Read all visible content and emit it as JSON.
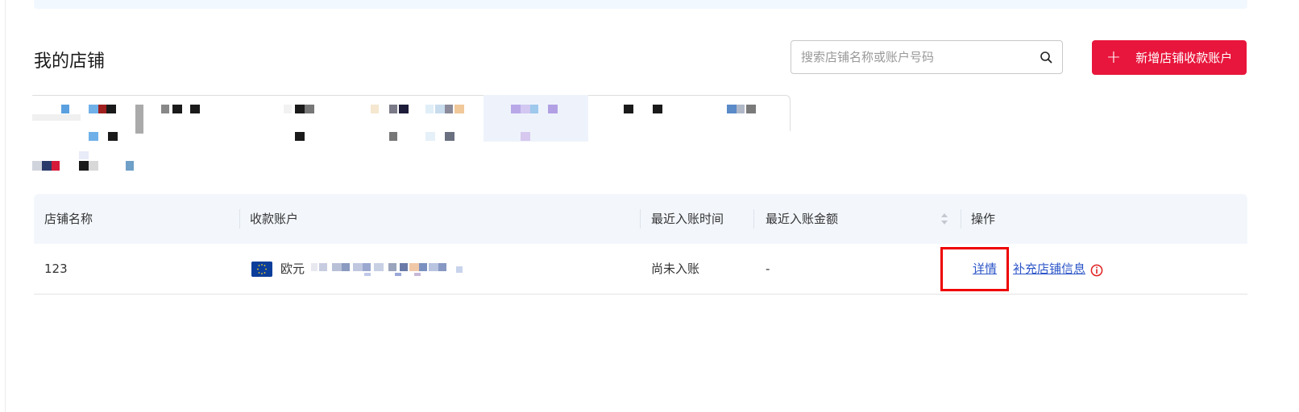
{
  "page": {
    "title": "我的店铺"
  },
  "search": {
    "placeholder": "搜索店铺名称或账户号码",
    "value": ""
  },
  "toolbar": {
    "add_icon": "+",
    "add_label": "新增店铺收款账户"
  },
  "table": {
    "columns": [
      "店铺名称",
      "收款账户",
      "最近入账时间",
      "最近入账金额",
      "操作"
    ],
    "rows": [
      {
        "shop_name": "123",
        "account_currency": "欧元",
        "last_time": "尚未入账",
        "last_amount": "-",
        "action_detail": "详情",
        "action_supplement": "补充店铺信息"
      }
    ]
  },
  "colors": {
    "accent": "#e8163c",
    "link": "#2d56c8",
    "highlight": "#ee0000",
    "header_bg": "#f3f7fc"
  },
  "icons": [
    "search-icon",
    "plus-icon",
    "sort-icon",
    "eu-flag-icon",
    "info-icon"
  ]
}
